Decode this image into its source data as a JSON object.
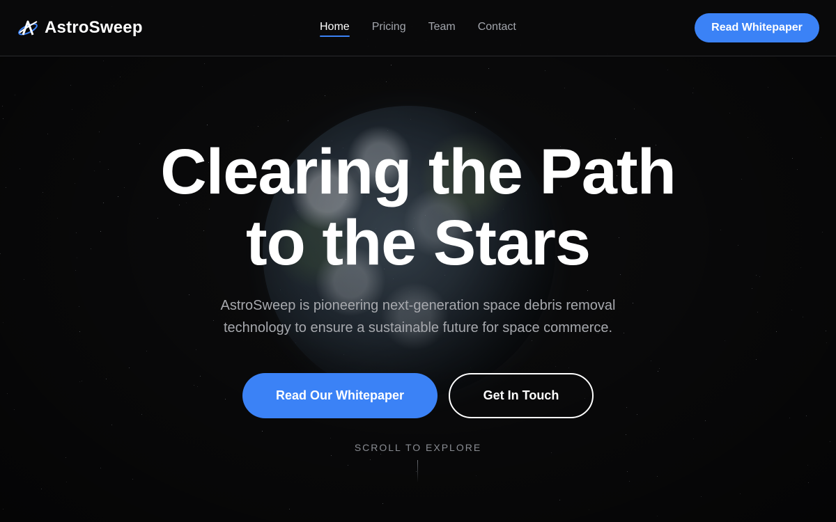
{
  "brand": {
    "name": "AstroSweep",
    "logo_icon": "astro-logo-icon"
  },
  "nav": {
    "items": [
      {
        "label": "Home",
        "active": true
      },
      {
        "label": "Pricing",
        "active": false
      },
      {
        "label": "Team",
        "active": false
      },
      {
        "label": "Contact",
        "active": false
      }
    ]
  },
  "header": {
    "cta_label": "Read Whitepaper"
  },
  "hero": {
    "title_line1": "Clearing the Path",
    "title_line2": "to the Stars",
    "subtitle": "AstroSweep is pioneering next-generation space debris removal technology to ensure a sustainable future for space commerce.",
    "primary_cta": "Read Our Whitepaper",
    "secondary_cta": "Get In Touch",
    "scroll_hint": "SCROLL TO EXPLORE"
  },
  "colors": {
    "accent": "#3b82f6",
    "background": "#0a0a0b",
    "muted_text": "#a7a9ae"
  }
}
